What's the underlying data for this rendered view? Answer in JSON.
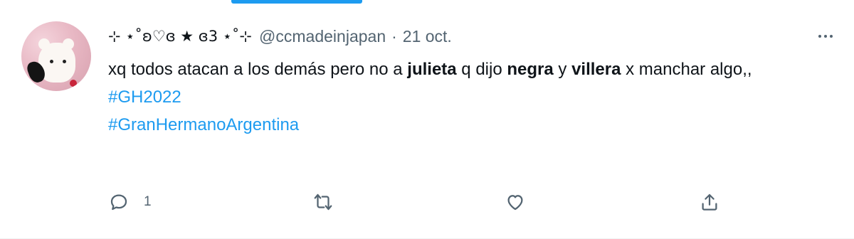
{
  "tweet": {
    "display_name": "⊹ ⋆˚ʚ♡ɞ ★ ɞ3 ⋆˚⊹",
    "handle": "@ccmadeinjapan",
    "separator": "·",
    "date": "21 oct.",
    "text": {
      "p1": "xq todos atacan a los demás pero no a ",
      "b1": "julieta",
      "p2": " q dijo ",
      "b2": "negra",
      "p3": " y ",
      "b3": "villera",
      "p4": " x manchar algo,,"
    },
    "hashtags": [
      "#GH2022",
      "#GranHermanoArgentina"
    ],
    "actions": {
      "reply_count": "1",
      "retweet_count": "",
      "like_count": ""
    }
  },
  "colors": {
    "accent": "#1d9bf0",
    "secondary_text": "#536471",
    "primary_text": "#0f1419"
  },
  "icons": [
    "avatar",
    "more-icon",
    "reply-icon",
    "retweet-icon",
    "like-icon",
    "share-icon"
  ]
}
